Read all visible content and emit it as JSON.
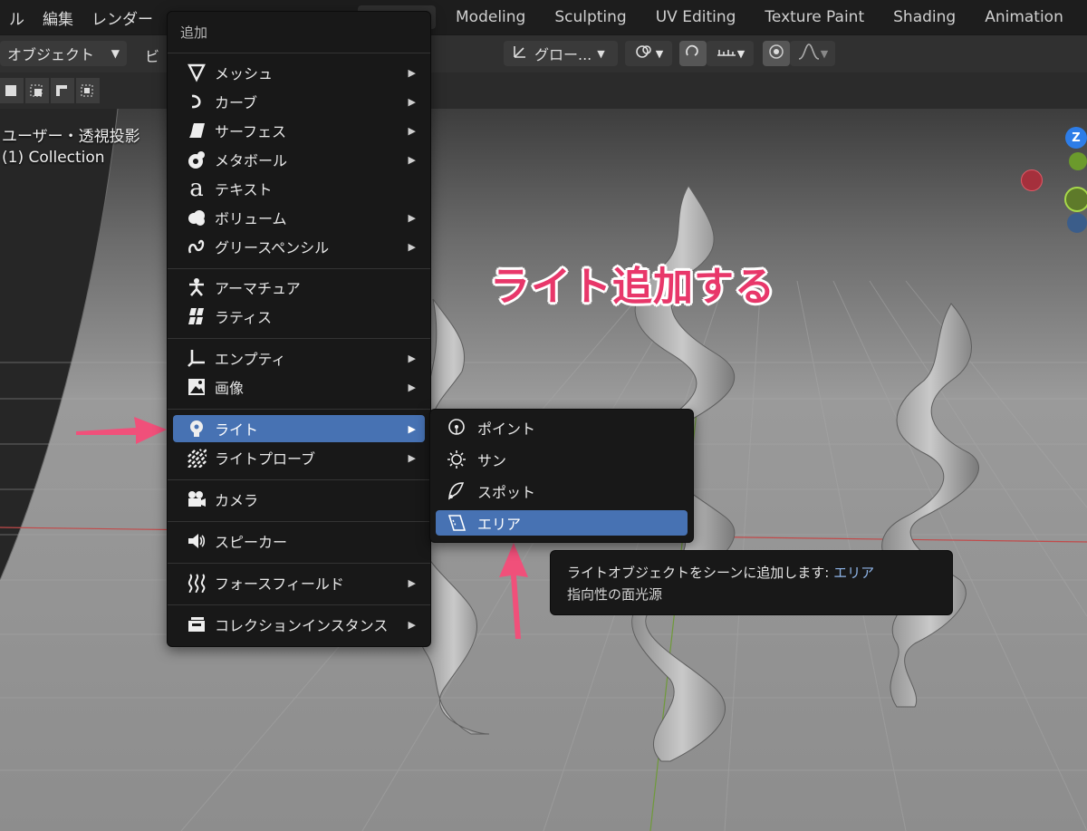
{
  "topbar": {
    "menus": [
      "ル",
      "編集",
      "レンダー"
    ],
    "workspace_tabs": [
      "Modeling",
      "Sculpting",
      "UV Editing",
      "Texture Paint",
      "Shading",
      "Animation"
    ]
  },
  "header": {
    "mode_label": "オブジェクト",
    "view_menu": "ビ",
    "orientation_label": "グロー..."
  },
  "viewport": {
    "view_name": "ユーザー・透視投影",
    "collection": "(1) Collection",
    "annotation": "ライト追加する",
    "gizmo_z_label": "Z"
  },
  "add_menu": {
    "title": "追加",
    "groups": [
      [
        {
          "label": "メッシュ",
          "icon": "mesh-icon",
          "submenu": true
        },
        {
          "label": "カーブ",
          "icon": "curve-icon",
          "submenu": true
        },
        {
          "label": "サーフェス",
          "icon": "surface-icon",
          "submenu": true
        },
        {
          "label": "メタボール",
          "icon": "metaball-icon",
          "submenu": true
        },
        {
          "label": "テキスト",
          "icon": "text-icon",
          "submenu": false
        },
        {
          "label": "ボリューム",
          "icon": "volume-icon",
          "submenu": true
        },
        {
          "label": "グリースペンシル",
          "icon": "grease-pencil-icon",
          "submenu": true
        }
      ],
      [
        {
          "label": "アーマチュア",
          "icon": "armature-icon",
          "submenu": false
        },
        {
          "label": "ラティス",
          "icon": "lattice-icon",
          "submenu": false
        }
      ],
      [
        {
          "label": "エンプティ",
          "icon": "empty-icon",
          "submenu": true
        },
        {
          "label": "画像",
          "icon": "image-icon",
          "submenu": true
        }
      ],
      [
        {
          "label": "ライト",
          "icon": "light-icon",
          "submenu": true,
          "highlighted": true
        },
        {
          "label": "ライトプローブ",
          "icon": "light-probe-icon",
          "submenu": true
        }
      ],
      [
        {
          "label": "カメラ",
          "icon": "camera-icon",
          "submenu": false
        }
      ],
      [
        {
          "label": "スピーカー",
          "icon": "speaker-icon",
          "submenu": false
        }
      ],
      [
        {
          "label": "フォースフィールド",
          "icon": "force-field-icon",
          "submenu": true
        }
      ],
      [
        {
          "label": "コレクションインスタンス",
          "icon": "collection-instance-icon",
          "submenu": true
        }
      ]
    ]
  },
  "light_submenu": {
    "items": [
      {
        "label": "ポイント",
        "icon": "point-light-icon"
      },
      {
        "label": "サン",
        "icon": "sun-light-icon"
      },
      {
        "label": "スポット",
        "icon": "spot-light-icon"
      },
      {
        "label": "エリア",
        "icon": "area-light-icon",
        "highlighted": true
      }
    ]
  },
  "tooltip": {
    "text": "ライトオブジェクトをシーンに追加します:",
    "target": "エリア",
    "description": "指向性の面光源"
  },
  "colors": {
    "highlight": "#4772b3",
    "annotation": "#e8376a",
    "arrow": "#f0507a"
  }
}
